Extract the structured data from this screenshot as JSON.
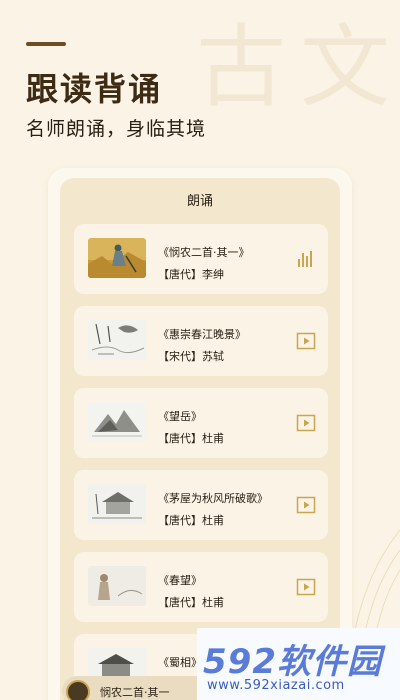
{
  "background_chars": "古文",
  "header": {
    "title": "跟读背诵",
    "subtitle": "名师朗诵，身临其境"
  },
  "panel": {
    "title": "朗诵"
  },
  "poems": [
    {
      "title": "《悯农二首·其一》",
      "author": "【唐代】李绅",
      "state": "playing",
      "icon": "equalizer-icon"
    },
    {
      "title": "《惠崇春江晚景》",
      "author": "【宋代】苏轼",
      "state": "paused",
      "icon": "play-icon"
    },
    {
      "title": "《望岳》",
      "author": "【唐代】杜甫",
      "state": "paused",
      "icon": "play-icon"
    },
    {
      "title": "《茅屋为秋风所破歌》",
      "author": "【唐代】杜甫",
      "state": "paused",
      "icon": "play-icon"
    },
    {
      "title": "《春望》",
      "author": "【唐代】杜甫",
      "state": "paused",
      "icon": "play-icon"
    },
    {
      "title": "《蜀相》",
      "author": "",
      "state": "paused",
      "icon": "play-icon"
    }
  ],
  "mini_player": {
    "text": "悯农二首·其一"
  },
  "watermark": {
    "logo": "592软件园",
    "url": "www.592xiazai.com"
  },
  "colors": {
    "background": "#fbf4e6",
    "panel": "#f3e7cd",
    "accent": "#c9a552",
    "title": "#3d2b14",
    "watermark": "#5a7bd8"
  }
}
